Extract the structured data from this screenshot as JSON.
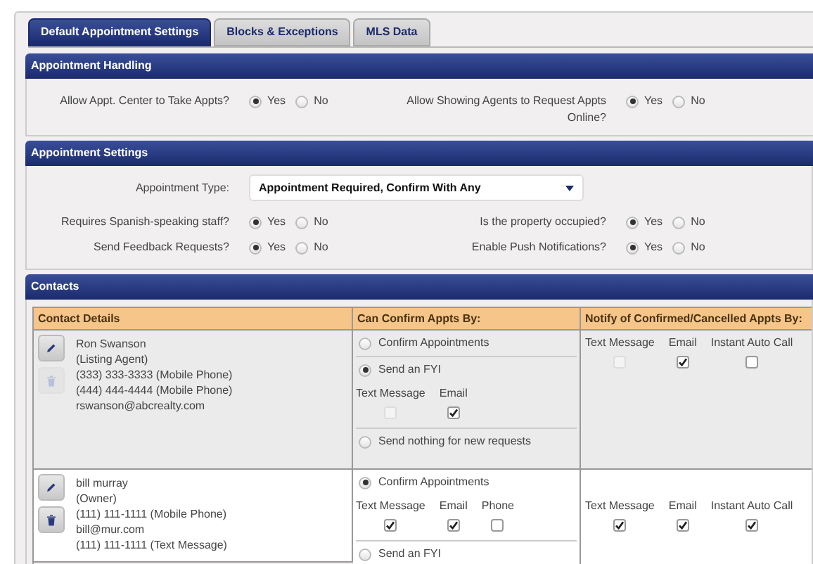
{
  "tabs": [
    {
      "label": "Default Appointment Settings",
      "selected": true
    },
    {
      "label": "Blocks & Exceptions",
      "selected": false
    },
    {
      "label": "MLS Data",
      "selected": false
    }
  ],
  "appointment_handling": {
    "title": "Appointment Handling",
    "questions": [
      {
        "label": "Allow Appt. Center to Take Appts?",
        "options": [
          {
            "label": "Yes",
            "selected": true
          },
          {
            "label": "No",
            "selected": false
          }
        ]
      },
      {
        "label": "Allow Showing Agents to Request Appts Online?",
        "options": [
          {
            "label": "Yes",
            "selected": true
          },
          {
            "label": "No",
            "selected": false
          }
        ]
      }
    ]
  },
  "appointment_settings": {
    "title": "Appointment Settings",
    "appointment_type": {
      "label": "Appointment Type:",
      "value": "Appointment Required, Confirm With Any"
    },
    "questions": [
      {
        "label": "Requires Spanish-speaking staff?",
        "options": [
          {
            "label": "Yes",
            "selected": true
          },
          {
            "label": "No",
            "selected": false
          }
        ]
      },
      {
        "label": "Is the property occupied?",
        "options": [
          {
            "label": "Yes",
            "selected": true
          },
          {
            "label": "No",
            "selected": false
          }
        ]
      },
      {
        "label": "Send Feedback Requests?",
        "options": [
          {
            "label": "Yes",
            "selected": true
          },
          {
            "label": "No",
            "selected": false
          }
        ]
      },
      {
        "label": "Enable Push Notifications?",
        "options": [
          {
            "label": "Yes",
            "selected": true
          },
          {
            "label": "No",
            "selected": false
          }
        ]
      }
    ]
  },
  "contacts": {
    "title": "Contacts",
    "columns": [
      "Contact Details",
      "Can Confirm Appts By:",
      "Notify of Confirmed/Cancelled Appts By:"
    ],
    "rows": [
      {
        "details": [
          "Ron Swanson",
          "(Listing Agent)",
          "(333) 333-3333 (Mobile Phone)",
          "(444) 444-4444 (Mobile Phone)",
          "rswanson@abcrealty.com"
        ],
        "delete_disabled": true,
        "confirm_options": [
          {
            "label": "Confirm Appointments",
            "selected": false
          },
          {
            "label": "Send an FYI",
            "selected": true,
            "channels": [
              {
                "label": "Text Message",
                "checked": false,
                "disabled": true
              },
              {
                "label": "Email",
                "checked": true,
                "disabled": false
              }
            ]
          },
          {
            "label": "Send nothing for new requests",
            "selected": false
          }
        ],
        "notify": [
          {
            "label": "Text Message",
            "checked": false,
            "disabled": true
          },
          {
            "label": "Email",
            "checked": true,
            "disabled": false
          },
          {
            "label": "Instant Auto Call",
            "checked": false,
            "disabled": false
          }
        ]
      },
      {
        "details": [
          "bill murray",
          "(Owner)",
          "(111) 111-1111 (Mobile Phone)",
          "bill@mur.com",
          "(111) 111-1111 (Text Message)"
        ],
        "delete_disabled": false,
        "confirm_options": [
          {
            "label": "Confirm Appointments",
            "selected": true,
            "channels": [
              {
                "label": "Text Message",
                "checked": true,
                "disabled": false
              },
              {
                "label": "Email",
                "checked": true,
                "disabled": false
              },
              {
                "label": "Phone",
                "checked": false,
                "disabled": false
              }
            ]
          },
          {
            "label": "Send an FYI",
            "selected": false
          }
        ],
        "notify": [
          {
            "label": "Text Message",
            "checked": true,
            "disabled": false
          },
          {
            "label": "Email",
            "checked": true,
            "disabled": false
          },
          {
            "label": "Instant Auto Call",
            "checked": true,
            "disabled": false
          }
        ]
      }
    ]
  }
}
